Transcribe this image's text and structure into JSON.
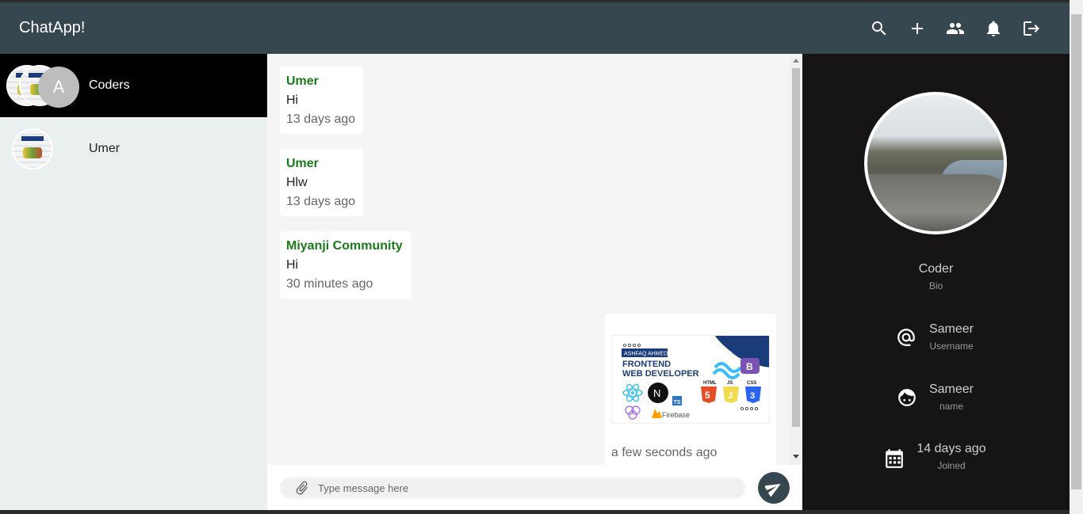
{
  "app": {
    "title": "ChatApp!"
  },
  "topbar": {
    "icons": [
      "search-icon",
      "add-icon",
      "group-icon",
      "notifications-icon",
      "logout-icon"
    ]
  },
  "sidebar": {
    "chats": [
      {
        "name": "Coders",
        "active": true,
        "avatar_letter": "A"
      },
      {
        "name": "Umer",
        "active": false
      }
    ]
  },
  "messages": [
    {
      "sender": "Umer",
      "text": "Hi",
      "time": "13 days ago"
    },
    {
      "sender": "Umer",
      "text": "Hlw",
      "time": "13 days ago"
    },
    {
      "sender": "Miyanji Community",
      "text": "Hi",
      "time": "30 minutes ago"
    }
  ],
  "image_message": {
    "time": "a few seconds ago",
    "attachment": {
      "tag": "ASHFAQ AHMED",
      "line1": "FRONTEND",
      "line2": "WEB DEVELOPER",
      "firebase": "Firebase",
      "html": "HTML",
      "js": "JS",
      "css": "CSS",
      "ts": "TS",
      "n": "N",
      "b": "B"
    }
  },
  "composer": {
    "placeholder": "Type message here"
  },
  "profile": {
    "bio_value": "Coder",
    "bio_label": "Bio",
    "username_value": "Sameer",
    "username_label": "Username",
    "name_value": "Sameer",
    "name_label": "name",
    "joined_value": "14 days ago",
    "joined_label": "Joined"
  },
  "colors": {
    "topbar": "#37474f",
    "sender": "#1b7a1b",
    "profile_bg": "#161414",
    "active_chat": "#000000"
  }
}
